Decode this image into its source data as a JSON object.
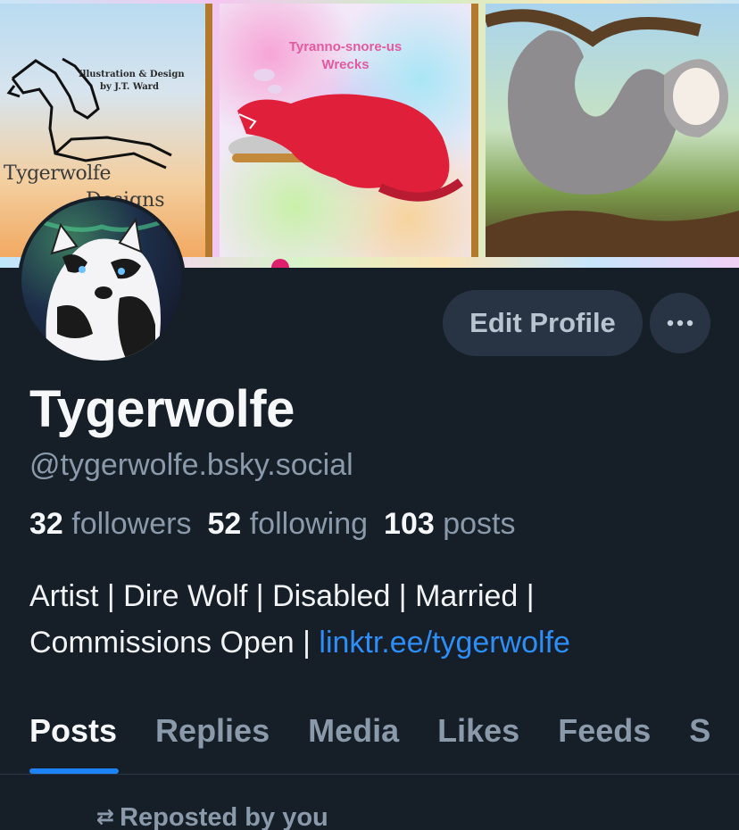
{
  "banner": {
    "logo_credit_line1": "Illustration & Design",
    "logo_credit_line2": "by J.T. Ward",
    "logo_wordmark": "Tygerwolfe",
    "logo_wordmark_2": "Designs",
    "trex_title_line1": "Tyranno-snore-us",
    "trex_title_line2": "Wrecks"
  },
  "profile": {
    "display_name": "Tygerwolfe",
    "handle": "@tygerwolfe.bsky.social",
    "followers_count": "32",
    "followers_label": "followers",
    "following_count": "52",
    "following_label": "following",
    "posts_count": "103",
    "posts_label": "posts",
    "bio_line1": "Artist | Dire Wolf | Disabled | Married |",
    "bio_line2_text": "Commissions Open | ",
    "bio_link": "linktr.ee/tygerwolfe"
  },
  "actions": {
    "edit_profile_label": "Edit Profile",
    "more_icon": "ellipsis-icon"
  },
  "tabs": [
    {
      "label": "Posts",
      "active": true
    },
    {
      "label": "Replies",
      "active": false
    },
    {
      "label": "Media",
      "active": false
    },
    {
      "label": "Likes",
      "active": false
    },
    {
      "label": "Feeds",
      "active": false
    },
    {
      "label": "S",
      "active": false
    }
  ],
  "feed": {
    "reposted_label": "Reposted by you",
    "repost_icon": "repost-icon"
  },
  "colors": {
    "background": "#161e27",
    "accent": "#1d83f5",
    "link": "#2e8ef7",
    "muted_text": "#8b9aab",
    "button_bg": "#283443"
  }
}
